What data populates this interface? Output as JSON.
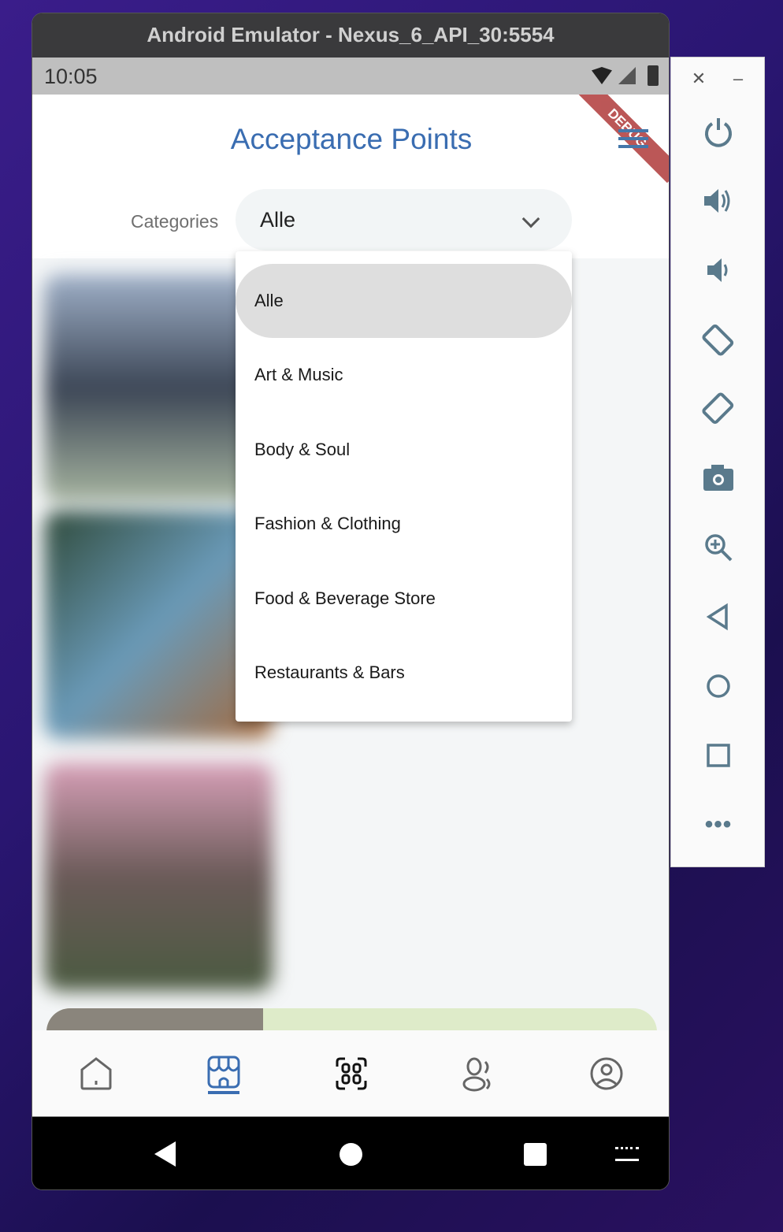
{
  "window": {
    "title": "Android Emulator - Nexus_6_API_30:5554"
  },
  "status_bar": {
    "time": "10:05",
    "debug_banner": "DEBUG"
  },
  "header": {
    "title": "Acceptance Points"
  },
  "filter": {
    "label": "Categories",
    "selected": "Alle",
    "options": [
      "Alle",
      "Art & Music",
      "Body & Soul",
      "Fashion & Clothing",
      "Food & Beverage Store",
      "Restaurants & Bars"
    ]
  },
  "bottom_nav": {
    "items": [
      "home-icon",
      "store-icon",
      "qr-scan-icon",
      "people-icon",
      "profile-icon"
    ],
    "active": "store-icon",
    "active_color": "#3a6db1"
  },
  "emulator_controls": [
    "power",
    "volume-up",
    "volume-down",
    "rotate-left",
    "rotate-right",
    "screenshot",
    "zoom",
    "back",
    "home",
    "overview",
    "more"
  ]
}
